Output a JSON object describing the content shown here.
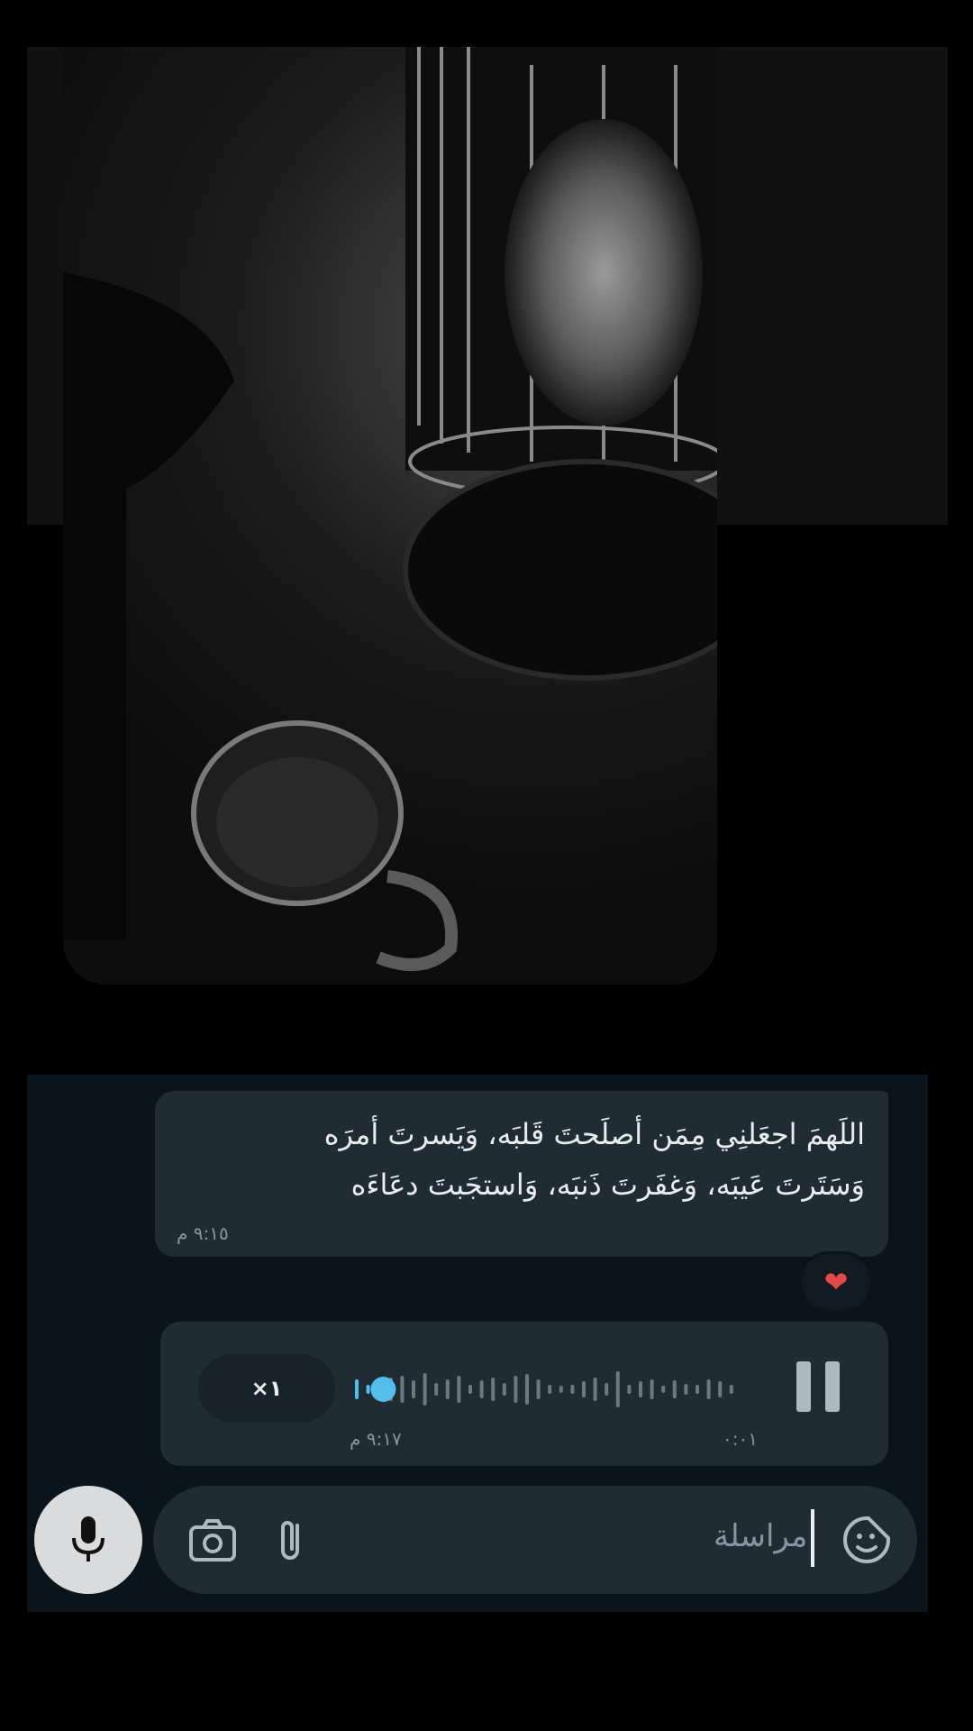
{
  "message": {
    "text_line1": "اللَهمَ اجعَلنِي مِمَن أصلَحتَ قَلبَه، وَيَسرتَ أمرَه",
    "text_line2": "وَسَتَرتَ عَيبَه، وَغفَرتَ ذَنبَه، وَاستجَبتَ دعَاءَه",
    "time": "٩:١٥ م",
    "reaction": "❤"
  },
  "voice_note": {
    "speed": "×١",
    "duration": "٠:٠١",
    "time": "٩:١٧ م",
    "progress": 0.05
  },
  "composer": {
    "placeholder": "مراسلة"
  },
  "colors": {
    "accent_blue": "#53bdeb",
    "bubble": "#202c33",
    "panel": "#0b141a",
    "input": "#1f2c33",
    "mic": "#d9dbdc"
  },
  "icons": [
    "mic-icon",
    "camera-icon",
    "attach-icon",
    "sticker-icon",
    "pause-icon",
    "heart-icon"
  ]
}
